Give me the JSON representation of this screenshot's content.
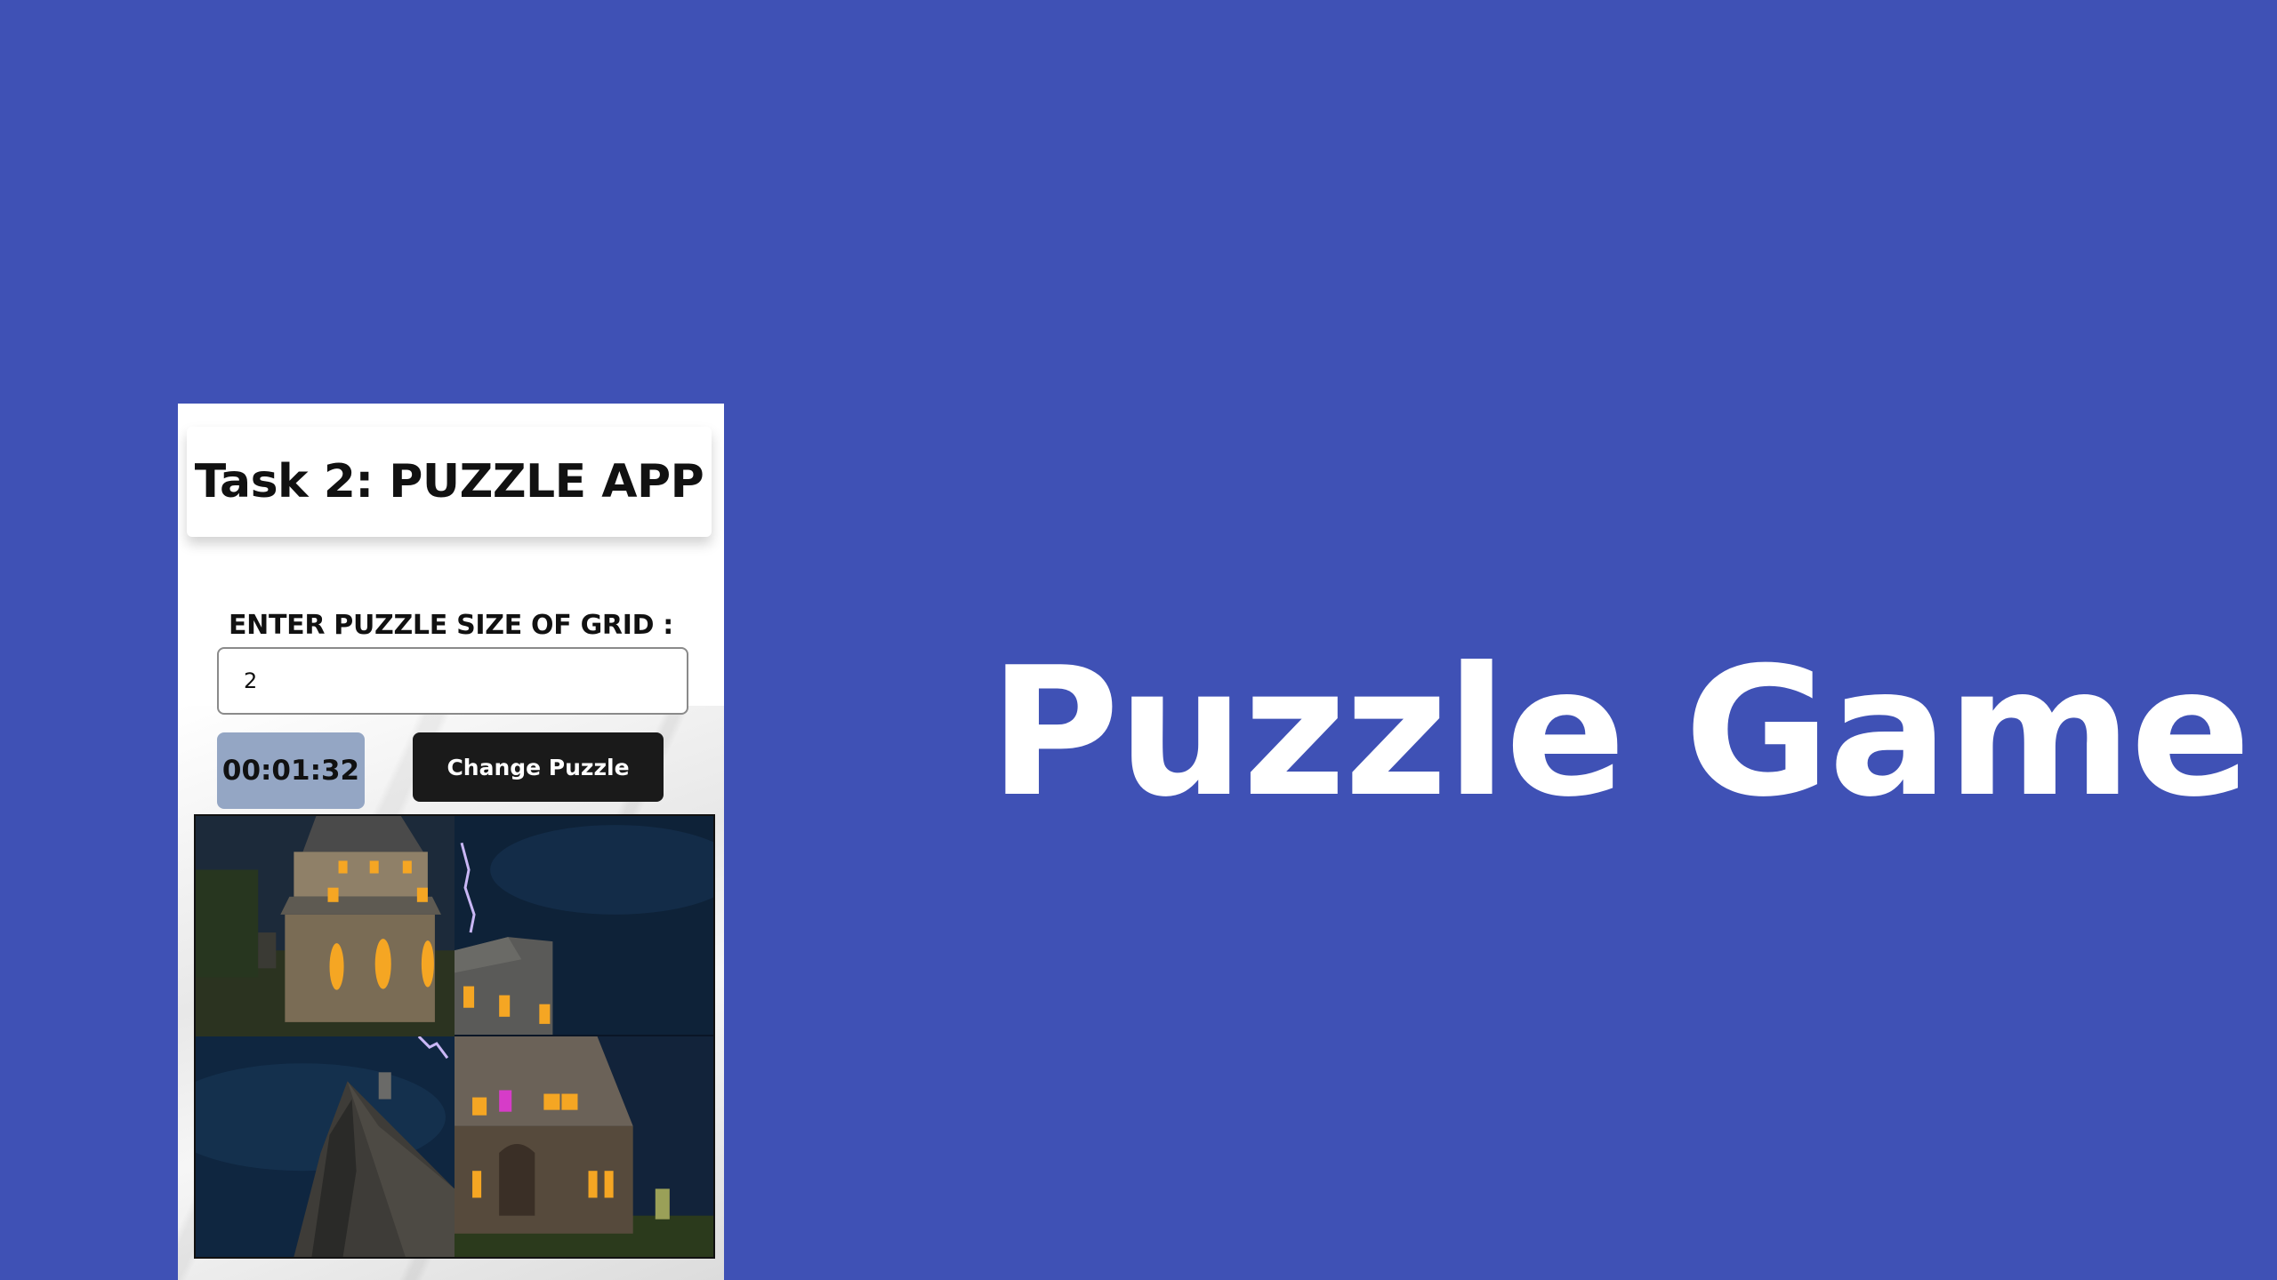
{
  "hero": {
    "title": "Puzzle Game"
  },
  "app": {
    "title": "Task 2: PUZZLE APP",
    "grid_size_label": "ENTER PUZZLE SIZE OF GRID :",
    "grid_size_value": "2",
    "timer": "00:01:32",
    "change_button_label": "Change Puzzle",
    "tiles": [
      {
        "icon": "house-tower-tile"
      },
      {
        "icon": "roof-lightning-tile"
      },
      {
        "icon": "roof-peak-tile"
      },
      {
        "icon": "house-door-tile"
      }
    ]
  },
  "colors": {
    "background": "#3f51b5",
    "timer_bg": "#94a6c4",
    "button_bg": "#1a1a1a",
    "window_glow": "#f5a623",
    "door_glow": "#d63cc8"
  }
}
